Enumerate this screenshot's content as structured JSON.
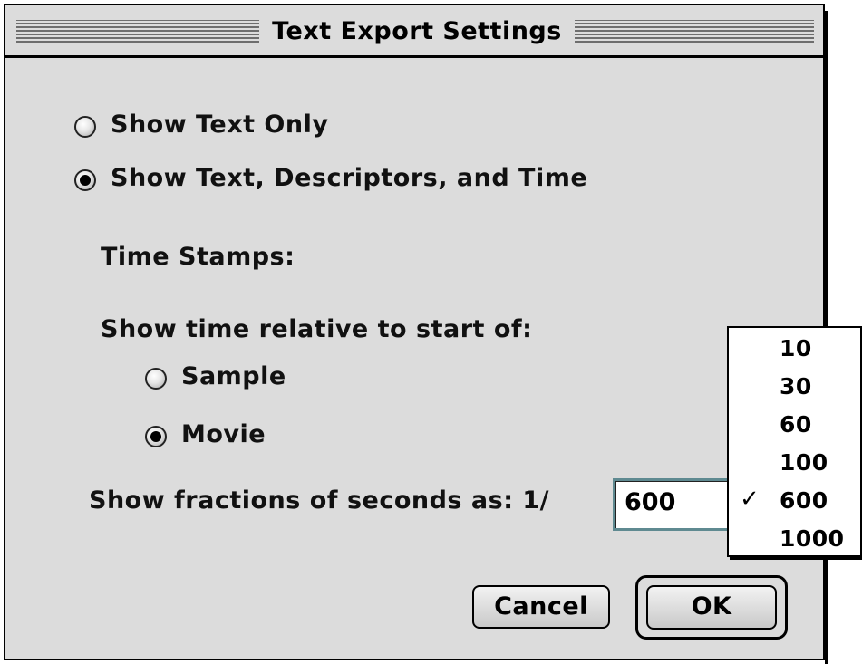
{
  "window": {
    "title": "Text Export Settings"
  },
  "options": {
    "show_text_only": "Show Text Only",
    "show_text_descriptors_time": "Show Text, Descriptors, and Time",
    "selected": "show_text_descriptors_time"
  },
  "time_stamps": {
    "heading": "Time Stamps:",
    "relative_label": "Show time relative to start of:",
    "sample_label": "Sample",
    "movie_label": "Movie",
    "selected": "movie",
    "fractions_label": "Show fractions of seconds as: 1/",
    "fractions_value": "600"
  },
  "popup": {
    "items": [
      "10",
      "30",
      "60",
      "100",
      "600",
      "1000"
    ],
    "checked_item": "600",
    "check_glyph": "✓"
  },
  "buttons": {
    "cancel": "Cancel",
    "ok": "OK"
  },
  "colors": {
    "window_bg": "#dcdcdc",
    "field_focus": "#5f8a91"
  }
}
